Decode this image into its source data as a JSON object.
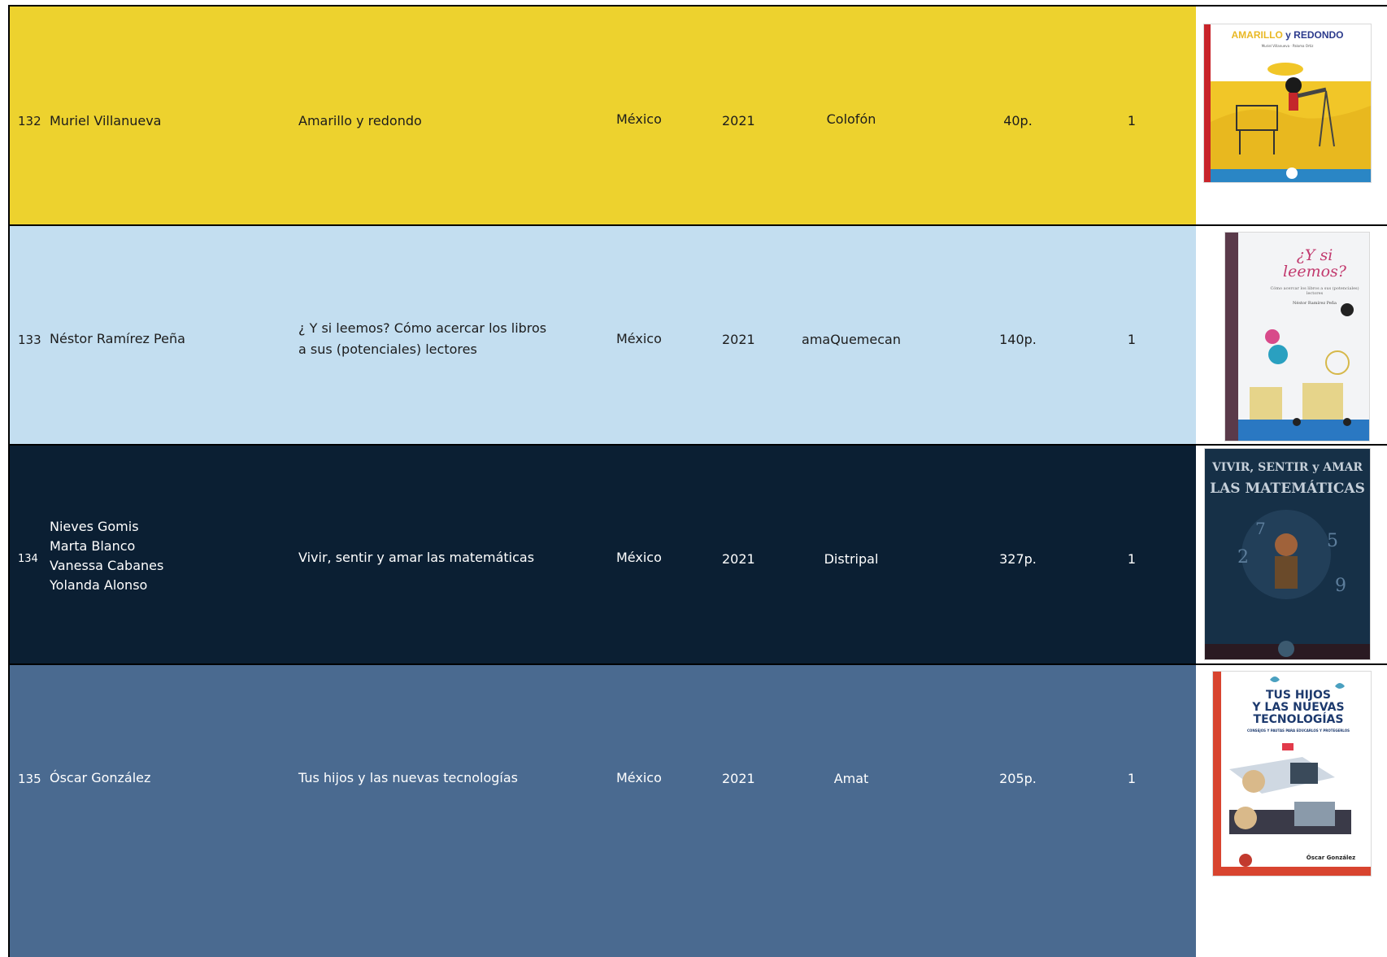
{
  "rows": [
    {
      "num": "132",
      "authors": [
        "Muriel Villanueva"
      ],
      "title": "Amarillo y redondo",
      "country": "México",
      "year": "2021",
      "publisher": "Colofón",
      "pages": "40p.",
      "qty": "1",
      "bg": "#EDD22E",
      "text_color": "#1c1c1c",
      "cover": {
        "title_a": "AMARILLO",
        "title_b": " y REDONDO",
        "byline": "Muriel Villanueva · Paloma Ortiz"
      }
    },
    {
      "num": "133",
      "authors": [
        "Néstor Ramírez Peña"
      ],
      "title": "¿ Y si leemos? Cómo acercar los libros a sus (potenciales) lectores",
      "country": "México",
      "year": "2021",
      "publisher": "amaQuemecan",
      "pages": "140p.",
      "qty": "1",
      "bg": "#C3DEF0",
      "text_color": "#1c1c1c",
      "cover": {
        "title_a": "¿Y si",
        "title_b": "leemos?",
        "subtitle": "Cómo acercar los libros a sus (potenciales) lectores",
        "byline": "Néstor Ramírez Peña"
      }
    },
    {
      "num": "134",
      "authors": [
        "Nieves Gomis",
        "Marta Blanco",
        "Vanessa Cabanes",
        "Yolanda Alonso"
      ],
      "title": "Vivir, sentir y amar las matemáticas",
      "country": "México",
      "year": "2021",
      "publisher": "Distripal",
      "pages": "327p.",
      "qty": "1",
      "bg": "#0B1F33",
      "text_color": "#ffffff",
      "cover": {
        "title_a": "VIVIR, SENTIR y AMAR",
        "title_b": "LAS MATEMÁTICAS"
      }
    },
    {
      "num": "135",
      "authors": [
        "Óscar González"
      ],
      "title": "Tus hijos y las nuevas tecnologías",
      "country": "México",
      "year": "2021",
      "publisher": "Amat",
      "pages": "205p.",
      "qty": "1",
      "bg": "#4A6A90",
      "text_color": "#ffffff",
      "cover": {
        "title_a": "TUS HIJOS",
        "title_b": "Y LAS NUEVAS",
        "title_c": "TECNOLOGÍAS",
        "subtitle": "CONSEJOS Y PAUTAS PARA EDUCARLOS Y PROTEGERLOS",
        "byline": "Óscar González"
      }
    }
  ]
}
